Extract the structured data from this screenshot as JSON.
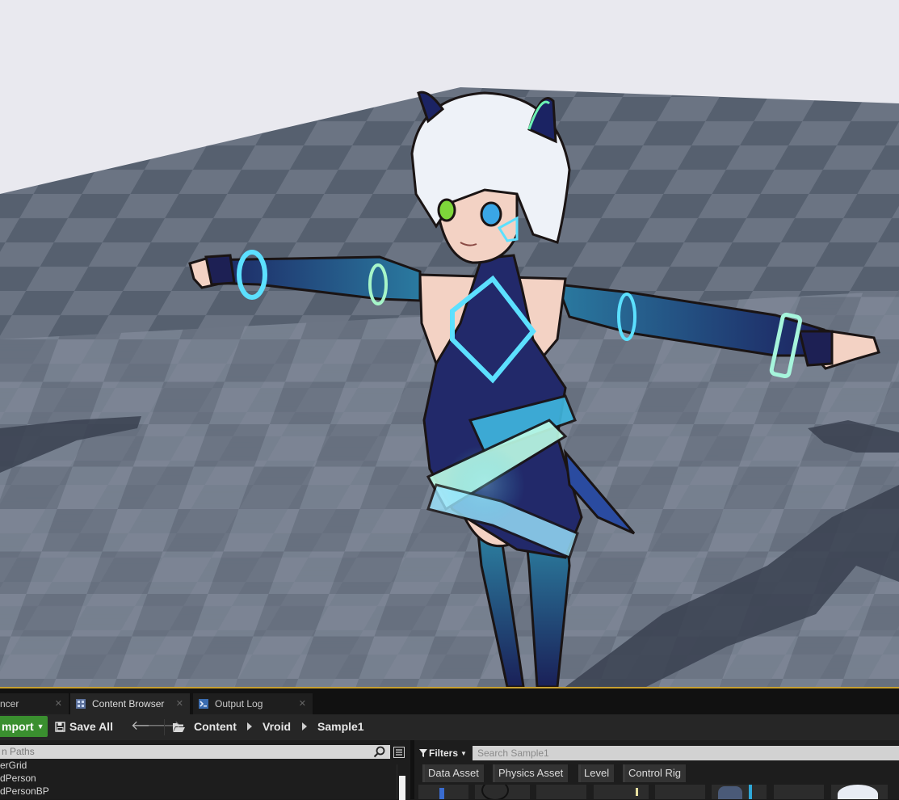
{
  "viewport": {
    "sky_color": "#e8e8ee",
    "floor_colors": [
      "#5a6372",
      "#7b8493"
    ],
    "character_colors": {
      "hair": "#eef2f8",
      "outfit": "#24306e",
      "accent": "#38d6f0",
      "skin": "#f3d2c4"
    }
  },
  "tabs": [
    {
      "label": "ncer",
      "icon": "sequencer-icon"
    },
    {
      "label": "Content Browser",
      "icon": "content-browser-icon"
    },
    {
      "label": "Output Log",
      "icon": "output-log-icon"
    }
  ],
  "toolbar": {
    "import_label": "mport",
    "save_all_label": "Save All",
    "breadcrumb": [
      "Content",
      "Vroid",
      "Sample1"
    ],
    "accent_color": "#3a8f2f"
  },
  "sources": {
    "search_placeholder": "n Paths",
    "items": [
      "erGrid",
      "dPerson",
      "dPersonBP"
    ]
  },
  "assets": {
    "filters_label": "Filters",
    "search_placeholder": "Search Sample1",
    "filter_chips": [
      "Data Asset",
      "Physics Asset",
      "Level",
      "Control Rig"
    ]
  }
}
